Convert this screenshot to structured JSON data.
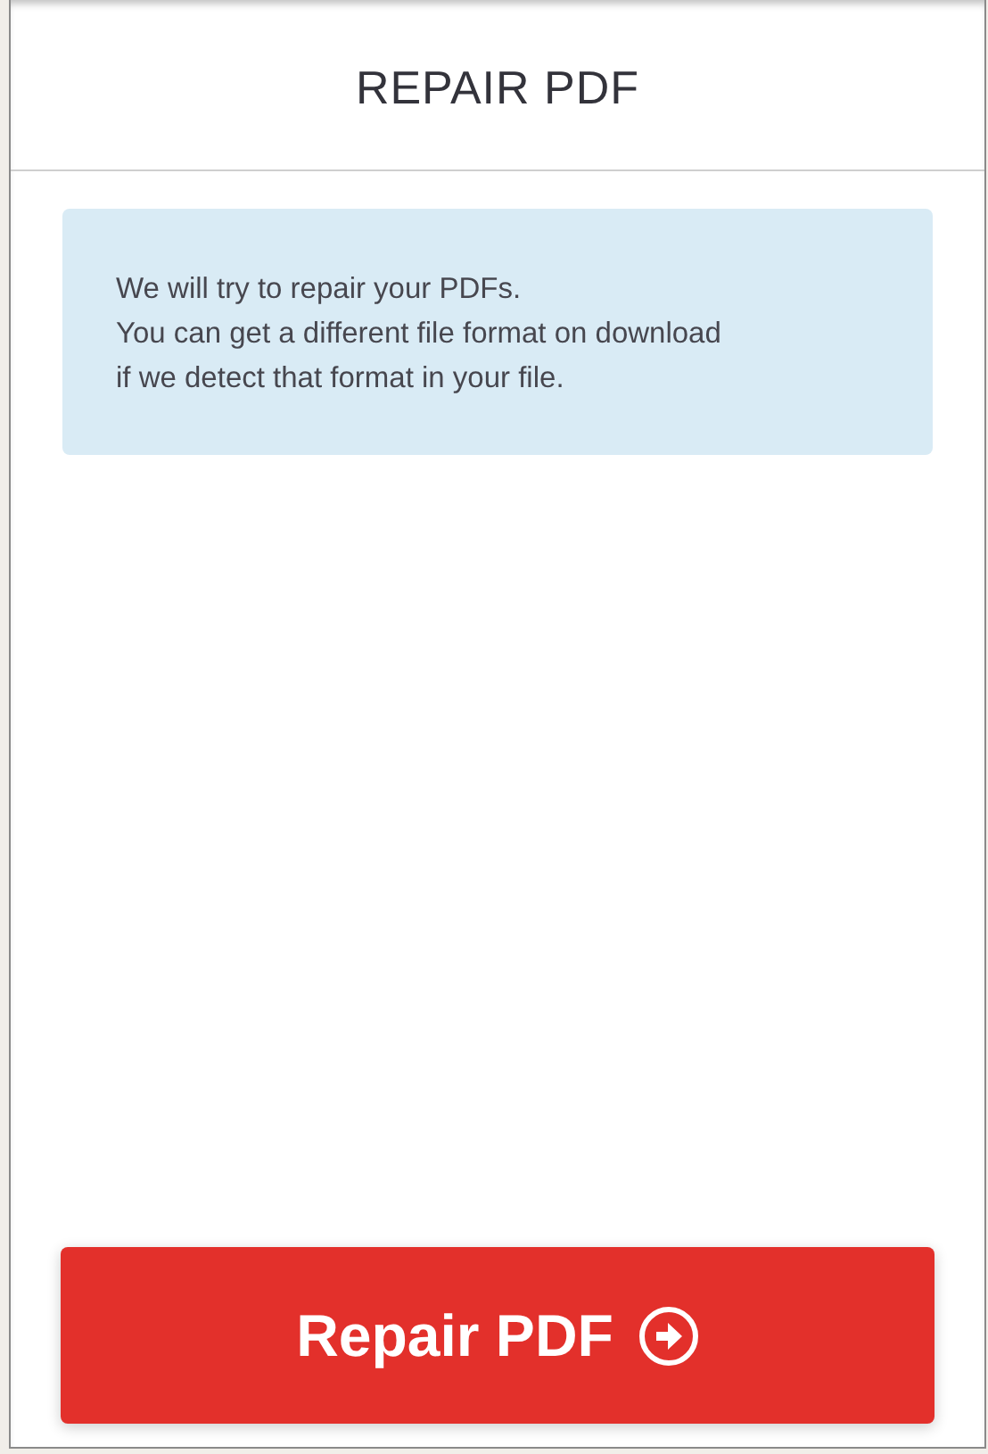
{
  "header": {
    "title": "REPAIR PDF"
  },
  "info": {
    "lines": [
      "We will try to repair your PDFs.",
      "You can get a different file format on download",
      "if we detect that format in your file."
    ]
  },
  "action_button": {
    "label": "Repair PDF"
  }
}
